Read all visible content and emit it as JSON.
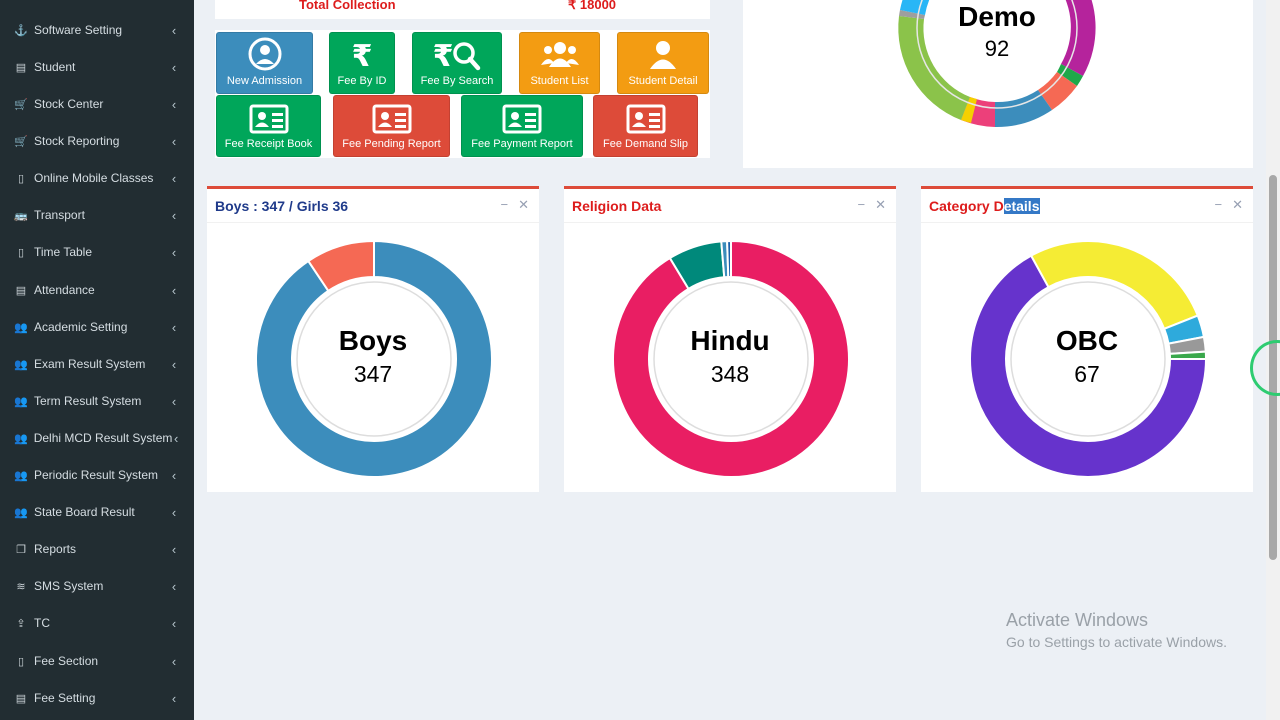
{
  "sidebar": {
    "items": [
      {
        "label": "Software Setting",
        "icon": "anchor-icon",
        "glyph": "⚓"
      },
      {
        "label": "Student",
        "icon": "id-card-icon",
        "glyph": "▤"
      },
      {
        "label": "Stock Center",
        "icon": "cart-icon",
        "glyph": "🛒"
      },
      {
        "label": "Stock Reporting",
        "icon": "cart-icon",
        "glyph": "🛒"
      },
      {
        "label": "Online Mobile Classes",
        "icon": "mobile-icon",
        "glyph": "▯"
      },
      {
        "label": "Transport",
        "icon": "bus-icon",
        "glyph": "🚌"
      },
      {
        "label": "Time Table",
        "icon": "mobile-icon",
        "glyph": "▯"
      },
      {
        "label": "Attendance",
        "icon": "id-card-icon",
        "glyph": "▤"
      },
      {
        "label": "Academic Setting",
        "icon": "users-icon",
        "glyph": "👥"
      },
      {
        "label": "Exam Result System",
        "icon": "users-icon",
        "glyph": "👥"
      },
      {
        "label": "Term Result System",
        "icon": "users-icon",
        "glyph": "👥"
      },
      {
        "label": "Delhi MCD Result System",
        "icon": "users-icon",
        "glyph": "👥"
      },
      {
        "label": "Periodic Result System",
        "icon": "users-icon",
        "glyph": "👥"
      },
      {
        "label": "State Board Result",
        "icon": "users-icon",
        "glyph": "👥"
      },
      {
        "label": "Reports",
        "icon": "copy-icon",
        "glyph": "❐"
      },
      {
        "label": "SMS System",
        "icon": "wifi-icon",
        "glyph": "≋"
      },
      {
        "label": "TC",
        "icon": "upload-icon",
        "glyph": "⇪"
      },
      {
        "label": "Fee Section",
        "icon": "mobile-icon",
        "glyph": "▯"
      },
      {
        "label": "Fee Setting",
        "icon": "id-card-icon",
        "glyph": "▤"
      }
    ]
  },
  "collection": {
    "label": "Total Collection",
    "value": "₹ 18000"
  },
  "shortcuts": {
    "new_admission": "New Admission",
    "fee_by_id": "Fee By ID",
    "fee_by_search": "Fee By Search",
    "student_list": "Student List",
    "student_detail": "Student Detail",
    "fee_receipt_book": "Fee Receipt Book",
    "fee_pending_report": "Fee Pending Report",
    "fee_payment_report": "Fee Payment Report",
    "fee_demand_slip": "Fee Demand Slip"
  },
  "demo": {
    "title": "Demo",
    "value": "92"
  },
  "panels": {
    "gender": {
      "title": "Boys : 347 / Girls 36",
      "center_title": "Boys",
      "center_value": "347"
    },
    "religion": {
      "title": "Religion Data",
      "center_title": "Hindu",
      "center_value": "348"
    },
    "category": {
      "title_plain": "Category D",
      "title_highlight": "etails",
      "center_title": "OBC",
      "center_value": "67"
    }
  },
  "watermark": {
    "line1": "Activate Windows",
    "line2": "Go to Settings to activate Windows."
  },
  "colors": {
    "sidebar": "#222d32",
    "blue": "#3c8dbc",
    "green": "#00a65a",
    "orange": "#f39c12",
    "red": "#dd4b39"
  },
  "chart_data": [
    {
      "type": "pie",
      "categories": [
        "Boys",
        "Girls"
      ],
      "values": [
        347,
        36
      ],
      "colors": [
        "#3c8dbc",
        "#f56954"
      ]
    },
    {
      "type": "pie",
      "categories": [
        "Hindu",
        "",
        "",
        ""
      ],
      "values": [
        348,
        28,
        3,
        2
      ],
      "colors": [
        "#e91e63",
        "#00897b",
        "#3c8dbc",
        "#1a5fa8"
      ]
    },
    {
      "type": "pie",
      "categories": [
        "OBC",
        "",
        "",
        "",
        ""
      ],
      "values": [
        67,
        27,
        3,
        2,
        1
      ],
      "colors": [
        "#6633cc",
        "#f5ec34",
        "#2eaadc",
        "#999999",
        "#3aa84b"
      ]
    }
  ]
}
